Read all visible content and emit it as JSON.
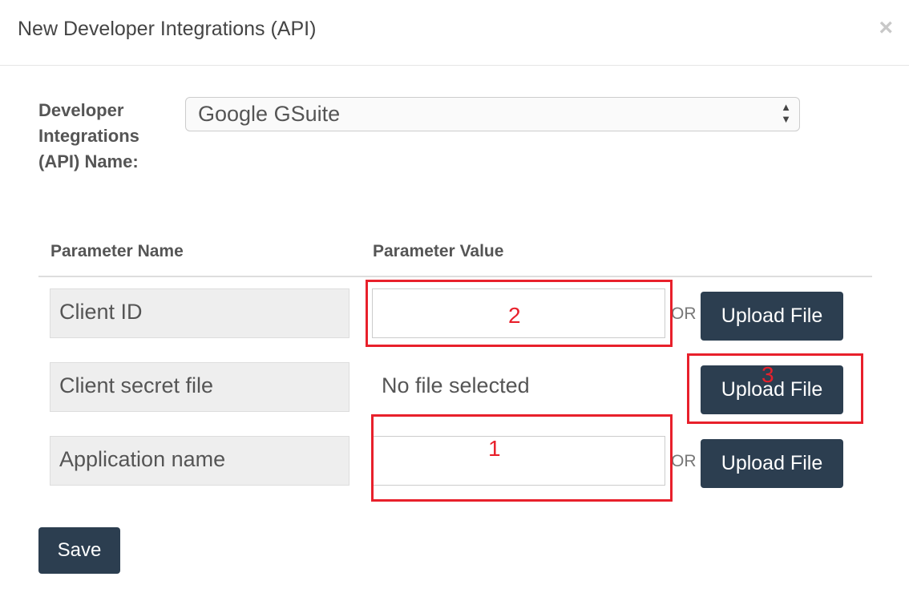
{
  "dialog": {
    "title": "New Developer Integrations (API)",
    "close_symbol": "×"
  },
  "integration": {
    "label": "Developer Integrations (API) Name:",
    "selected": "Google GSuite"
  },
  "table": {
    "headers": [
      "Parameter Name",
      "Parameter Value"
    ],
    "rows": [
      {
        "name": "Client ID",
        "value": "",
        "or_label": "OR",
        "upload_label": "Upload File"
      },
      {
        "name": "Client secret file",
        "file_status": "No file selected",
        "upload_label": "Upload File"
      },
      {
        "name": "Application name",
        "value": "",
        "or_label": "OR",
        "upload_label": "Upload File"
      }
    ]
  },
  "annotations": [
    "2",
    "3",
    "1"
  ],
  "actions": {
    "save_label": "Save"
  },
  "colors": {
    "button": "#2c3e50",
    "annotation": "#e8202b"
  }
}
